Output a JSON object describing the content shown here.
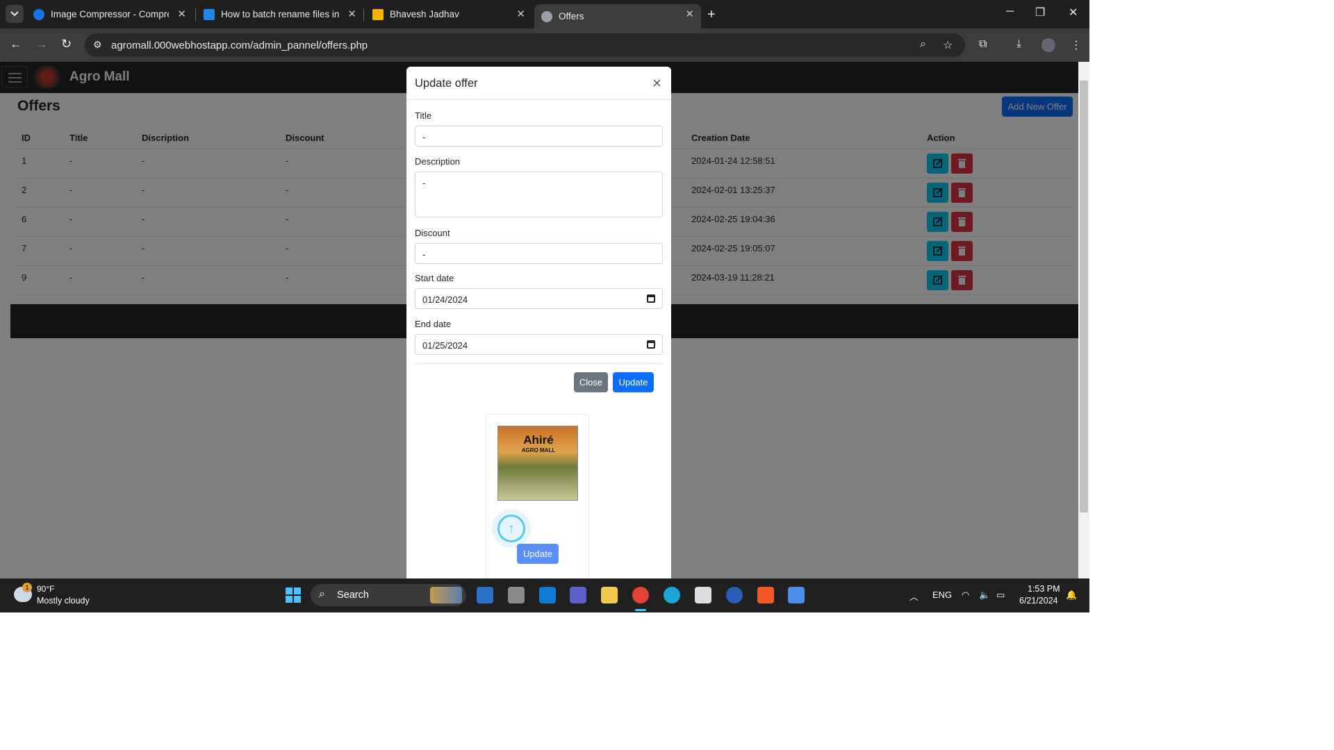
{
  "browser": {
    "tabs": [
      {
        "title": "Image Compressor - Compress",
        "color": "#1a73e8"
      },
      {
        "title": "How to batch rename files in W",
        "color": "#1e88e5"
      },
      {
        "title": "Bhavesh Jadhav",
        "color": "#f4b400"
      },
      {
        "title": "Offers",
        "color": "#9aa0a6"
      }
    ],
    "url": "agromall.000webhostapp.com/admin_pannel/offers.php"
  },
  "app": {
    "brand": "Agro Mall",
    "page_title": "Offers",
    "add_button": "Add New Offer",
    "columns": [
      "ID",
      "Title",
      "Discription",
      "Discount",
      "Creation Date",
      "Action"
    ],
    "rows": [
      {
        "id": "1",
        "title": "-",
        "description": "-",
        "discount": "-",
        "created": "2024-01-24 12:58:51"
      },
      {
        "id": "2",
        "title": "-",
        "description": "-",
        "discount": "-",
        "created": "2024-02-01 13:25:37"
      },
      {
        "id": "6",
        "title": "-",
        "description": "-",
        "discount": "-",
        "created": "2024-02-25 19:04:36"
      },
      {
        "id": "7",
        "title": "-",
        "description": "-",
        "discount": "-",
        "created": "2024-02-25 19:05:07"
      },
      {
        "id": "9",
        "title": "-",
        "description": "-",
        "discount": "-",
        "created": "2024-03-19 11:28:21"
      }
    ]
  },
  "modal": {
    "title": "Update offer",
    "close_icon": "×",
    "fields": {
      "title_label": "Title",
      "title_value": "-",
      "description_label": "Description",
      "description_value": "-",
      "discount_label": "Discount",
      "discount_value": "-",
      "start_label": "Start date",
      "start_value": "01/24/2024",
      "end_label": "End date",
      "end_value": "01/25/2024"
    },
    "close_button": "Close",
    "update_button": "Update",
    "poster_title": "Ahiré",
    "poster_subtitle": "AGRO MALL",
    "upload_button": "Update"
  },
  "taskbar": {
    "weather_temp": "90°F",
    "weather_desc": "Mostly cloudy",
    "weather_badge": "1",
    "search": "Search",
    "lang": "ENG",
    "time": "1:53 PM",
    "date": "6/21/2024"
  },
  "colors": {
    "primary": "#0d6efd",
    "info": "#0dcaf0",
    "danger": "#dc3545",
    "secondary": "#6c757d"
  }
}
